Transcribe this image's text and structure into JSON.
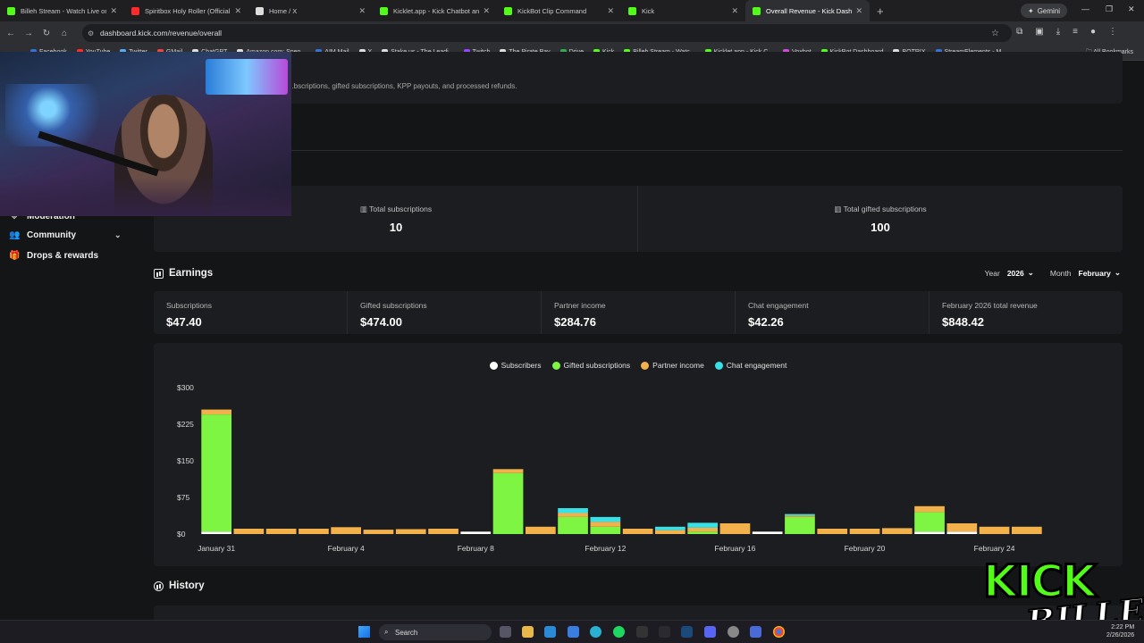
{
  "browser": {
    "tabs": [
      {
        "label": "Billeh Stream - Watch Live on K",
        "color": "#53fc18"
      },
      {
        "label": "Spiritbox Holy Roller (Official M",
        "color": "#ff2a2a"
      },
      {
        "label": "Home / X",
        "color": "#dddddd"
      },
      {
        "label": "Kicklet.app - Kick Chatbot and",
        "color": "#53fc18"
      },
      {
        "label": "KickBot Clip Command",
        "color": "#53fc18"
      },
      {
        "label": "Kick",
        "color": "#53fc18"
      },
      {
        "label": "Overall Revenue - Kick Dashbo",
        "color": "#53fc18"
      }
    ],
    "gemini_label": "Gemini",
    "url": "dashboard.kick.com/revenue/overall",
    "bookmarks": [
      {
        "label": "Facebook",
        "color": "#3b6fd8"
      },
      {
        "label": "YouTube",
        "color": "#ff2a2a"
      },
      {
        "label": "Twitter",
        "color": "#5aa8f0"
      },
      {
        "label": "GMail",
        "color": "#e44"
      },
      {
        "label": "ChatGPT",
        "color": "#ddd"
      },
      {
        "label": "Amazon.com: Spen...",
        "color": "#ddd"
      },
      {
        "label": "AIM Mail",
        "color": "#3b6fd8"
      },
      {
        "label": "X",
        "color": "#ddd"
      },
      {
        "label": "Stake.us - The Leadi...",
        "color": "#ddd"
      },
      {
        "label": "Twitch",
        "color": "#9146ff"
      },
      {
        "label": "The Pirate Bay",
        "color": "#ddd"
      },
      {
        "label": "Drive",
        "color": "#34a853"
      },
      {
        "label": "Kick",
        "color": "#53fc18"
      },
      {
        "label": "Billeh Stream - Watc...",
        "color": "#53fc18"
      },
      {
        "label": "Kicklet.app - Kick C...",
        "color": "#53fc18"
      },
      {
        "label": "Voxbot",
        "color": "#d04ad8"
      },
      {
        "label": "KickBot Dashboard",
        "color": "#53fc18"
      },
      {
        "label": "BOTRIX",
        "color": "#ddd"
      },
      {
        "label": "StreamElements - M...",
        "color": "#3b6fd8"
      }
    ],
    "all_bookmarks": "All Bookmarks"
  },
  "sidebar": {
    "items": [
      {
        "label": "Moderation",
        "icon": "shield-icon"
      },
      {
        "label": "Community",
        "icon": "people-icon"
      },
      {
        "label": "Drops & rewards",
        "icon": "gift-icon"
      }
    ]
  },
  "top_card": {
    "description": "...bscriptions, gifted subscriptions, KPP payouts, and processed refunds."
  },
  "subscriptions": {
    "total_label": "Total subscriptions",
    "total_value": "10",
    "gifted_label": "Total gifted subscriptions",
    "gifted_value": "100"
  },
  "earnings": {
    "title": "Earnings",
    "year_label": "Year",
    "year_value": "2026",
    "month_label": "Month",
    "month_value": "February",
    "cells": [
      {
        "label": "Subscriptions",
        "value": "$47.40"
      },
      {
        "label": "Gifted subscriptions",
        "value": "$474.00"
      },
      {
        "label": "Partner income",
        "value": "$284.76"
      },
      {
        "label": "Chat engagement",
        "value": "$42.26"
      },
      {
        "label": "February 2026 total revenue",
        "value": "$848.42"
      }
    ]
  },
  "colors": {
    "subscribers": "#ffffff",
    "gifted": "#7df542",
    "partner": "#f2b14b",
    "chat": "#38e0e8"
  },
  "chart_data": {
    "type": "bar",
    "stacked": true,
    "legend_position": "top-center",
    "y_tick_labels": [
      "$300",
      "$225",
      "$150",
      "$75",
      "$0"
    ],
    "y_ticks": [
      300,
      225,
      150,
      75,
      0
    ],
    "ylim": [
      0,
      300
    ],
    "x_tick_labels": [
      "January 31",
      "February 4",
      "February 8",
      "February 12",
      "February 16",
      "February 20",
      "February 24"
    ],
    "x_tick_index": [
      0,
      4,
      8,
      12,
      16,
      20,
      24
    ],
    "categories": [
      "Jan 31",
      "Feb 1",
      "Feb 2",
      "Feb 3",
      "Feb 4",
      "Feb 5",
      "Feb 6",
      "Feb 7",
      "Feb 8",
      "Feb 9",
      "Feb 10",
      "Feb 11",
      "Feb 12",
      "Feb 13",
      "Feb 14",
      "Feb 15",
      "Feb 16",
      "Feb 17",
      "Feb 18",
      "Feb 19",
      "Feb 20",
      "Feb 21",
      "Feb 22",
      "Feb 23",
      "Feb 24",
      "Feb 25"
    ],
    "series": [
      {
        "name": "Subscribers",
        "key": "subscribers",
        "values": [
          5,
          0,
          0,
          0,
          0,
          0,
          0,
          0,
          5,
          0,
          0,
          0,
          0,
          0,
          0,
          0,
          0,
          5,
          0,
          0,
          0,
          0,
          5,
          5,
          0,
          0
        ]
      },
      {
        "name": "Gifted subscriptions",
        "key": "gifted",
        "values": [
          240,
          0,
          0,
          0,
          0,
          0,
          0,
          0,
          0,
          125,
          0,
          35,
          15,
          0,
          0,
          5,
          0,
          0,
          35,
          0,
          0,
          0,
          40,
          0,
          0,
          0
        ]
      },
      {
        "name": "Partner income",
        "key": "partner",
        "values": [
          10,
          11,
          11,
          11,
          14,
          9,
          10,
          11,
          0,
          8,
          15,
          8,
          10,
          11,
          8,
          8,
          22,
          0,
          3,
          11,
          11,
          12,
          12,
          17,
          15,
          15
        ]
      },
      {
        "name": "Chat engagement",
        "key": "chat",
        "values": [
          0,
          0,
          0,
          0,
          0,
          0,
          0,
          0,
          0,
          0,
          0,
          10,
          10,
          0,
          7,
          10,
          0,
          0,
          3,
          0,
          0,
          0,
          0,
          0,
          0,
          0
        ]
      }
    ]
  },
  "history": {
    "title": "History"
  },
  "taskbar": {
    "search_placeholder": "Search",
    "time": "2:22 PM",
    "date": "2/26/2026"
  },
  "overlay": {
    "logo_line1": "KICK",
    "logo_line2": "BILLEH"
  }
}
